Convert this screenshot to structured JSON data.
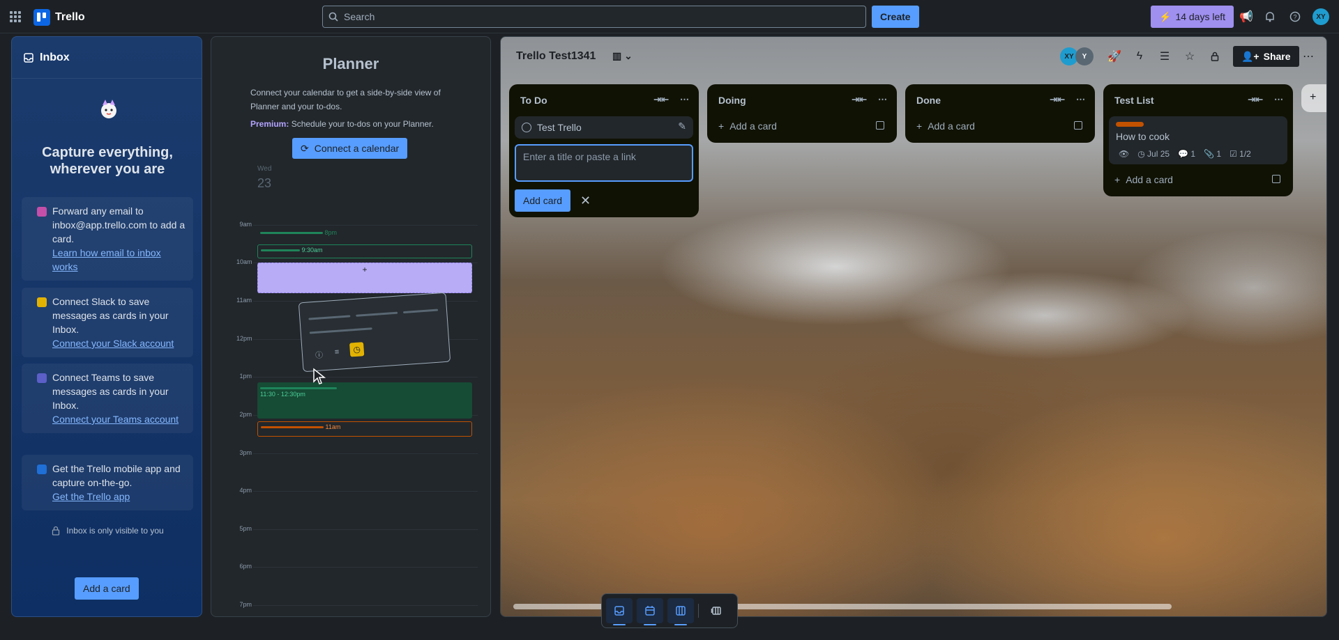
{
  "topbar": {
    "app_name": "Trello",
    "search_placeholder": "Search",
    "create_label": "Create",
    "trial_label": "14 days left",
    "avatar_initials": "XY"
  },
  "inbox": {
    "title": "Inbox",
    "heading": "Capture everything, wherever you are",
    "tips": [
      {
        "text": "Forward any email to inbox@app.trello.com to add a card.",
        "link": "Learn how email to inbox works",
        "icon": "email-icon",
        "color": "#c44fa9"
      },
      {
        "text": "Connect Slack to save messages as cards in your Inbox.",
        "link": "Connect your Slack account",
        "icon": "slack-icon",
        "color": "#e2b203"
      },
      {
        "text": "Connect Teams to save messages as cards in your Inbox.",
        "link": "Connect your Teams account",
        "icon": "teams-icon",
        "color": "#5b5fc7"
      },
      {
        "text": "Get the Trello mobile app and capture on-the-go.",
        "link": "Get the Trello app",
        "icon": "mobile-icon",
        "color": "#1f6fd6"
      }
    ],
    "private_note": "Inbox is only visible to you",
    "add_card_label": "Add a card"
  },
  "planner": {
    "title": "Planner",
    "description": "Connect your calendar to get a side-by-side view of Planner and your to-dos.",
    "premium_label": "Premium:",
    "premium_text": "Schedule your to-dos on your Planner.",
    "connect_label": "Connect a calendar",
    "day": "Wed",
    "date": "23",
    "hours": [
      "9am",
      "10am",
      "11am",
      "12pm",
      "1pm",
      "2pm",
      "3pm",
      "4pm",
      "5pm",
      "6pm",
      "7pm"
    ],
    "events": [
      {
        "label": "8pm",
        "color": "#1f845a"
      },
      {
        "label": "9:30am",
        "color": "#1f845a"
      },
      {
        "label": "11:30 - 12:30pm",
        "color": "#1f845a"
      },
      {
        "label": "11am",
        "color": "#c25100"
      }
    ]
  },
  "board": {
    "title": "Trello Test1341",
    "share_label": "Share",
    "members": [
      {
        "initials": "XY",
        "color": "#1f9ccf"
      },
      {
        "initials": "Y",
        "color": "#596773"
      }
    ],
    "lists": [
      {
        "name": "To Do",
        "cards": [
          {
            "title": "Test Trello"
          }
        ],
        "composer_placeholder": "Enter a title or paste a link",
        "composer_button": "Add card"
      },
      {
        "name": "Doing",
        "add_label": "Add a card"
      },
      {
        "name": "Done",
        "add_label": "Add a card"
      },
      {
        "name": "Test List",
        "cards": [
          {
            "title": "How to cook",
            "label_color": "#c25100",
            "due": "Jul 25",
            "comments": "1",
            "attachments": "1",
            "checklist": "1/2"
          }
        ],
        "add_label": "Add a card"
      }
    ]
  },
  "switcher": {
    "items": [
      "inbox-view-icon",
      "planner-view-icon",
      "board-view-icon",
      "switch-boards-icon"
    ]
  }
}
